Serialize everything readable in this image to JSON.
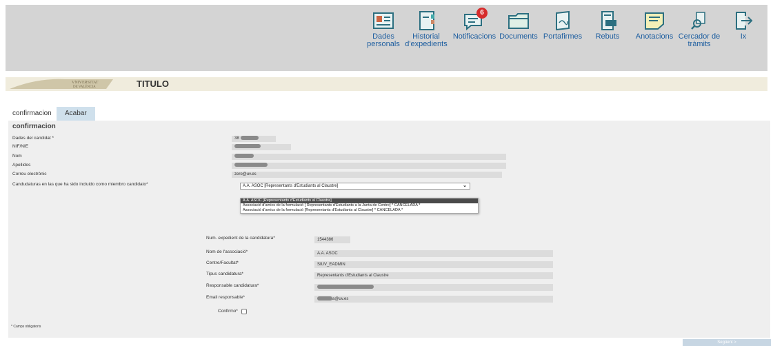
{
  "nav": {
    "items": [
      {
        "label": "Dades personals",
        "icon": "id-card-icon"
      },
      {
        "label": "Historial d'expedients",
        "icon": "binder-icon"
      },
      {
        "label": "Notificacions",
        "icon": "chat-bubble-icon",
        "badge": "6"
      },
      {
        "label": "Documents",
        "icon": "folder-icon"
      },
      {
        "label": "Portafirmes",
        "icon": "signature-book-icon"
      },
      {
        "label": "Rebuts",
        "icon": "receipt-icon"
      },
      {
        "label": "Anotacions",
        "icon": "note-icon"
      },
      {
        "label": "Cercador de tràmits",
        "icon": "search-document-icon"
      },
      {
        "label": "Ix",
        "icon": "logout-icon"
      }
    ]
  },
  "brand": {
    "logo_text_1": "VNIVERSITAT",
    "logo_text_2": "DE VALÈNCIA",
    "title": "TITULO"
  },
  "tabs": [
    {
      "label": "confirmacion"
    },
    {
      "label": "Acabar"
    }
  ],
  "section": {
    "title": "confirmacion"
  },
  "form": {
    "candidate_label": "Dades del candidat *",
    "candidate_value": "38",
    "nif_label": "NIF/NIE",
    "nom_label": "Nom",
    "apellidos_label": "Apellidos",
    "email_label": "Correu electrònic",
    "email_value": "zero@uv.es",
    "candidaturas_label": "Candudaturas en las que ha sido incluido como miembro candidato*",
    "candidaturas_selected": "A.A. ASOC [Representants d'Estudiants al Claustre]",
    "candidaturas_options": [
      "A.A. ASOC [Representants d'Estudiants al Claustre]",
      "Associació d'amics de la formulació [ Representants d'Estudiants a la Junta de Centre] * CANCELADA *",
      "Associació d'amics de la formulació [Representants d'Estudiants al Claustre] * CANCELADA *"
    ]
  },
  "detail": {
    "expedient_label": "Num. expedient de la candidatura*",
    "expedient_value": "1544386",
    "associacio_label": "Nom de l'associació*",
    "associacio_value": "A.A. ASOC",
    "centre_label": "Centre/Facultat*",
    "centre_value": "SIUV_EADMIN",
    "tipus_label": "Tipus candidatura*",
    "tipus_value": "Representants d'Estudiants al Claustre",
    "responsable_label": "Responsable candidatura*",
    "email_resp_label": "Email responsable*",
    "email_resp_value": "a@uv.es",
    "confirmo_label": "Confirmo*"
  },
  "footer": {
    "required_note": "* Camps obligatoris",
    "next_label": "Següent >"
  },
  "colors": {
    "nav_text": "#1f5fa0",
    "icon_teal": "#2c8c8c",
    "badge": "#d62b2b",
    "tab_inactive": "#cfe0ec"
  }
}
